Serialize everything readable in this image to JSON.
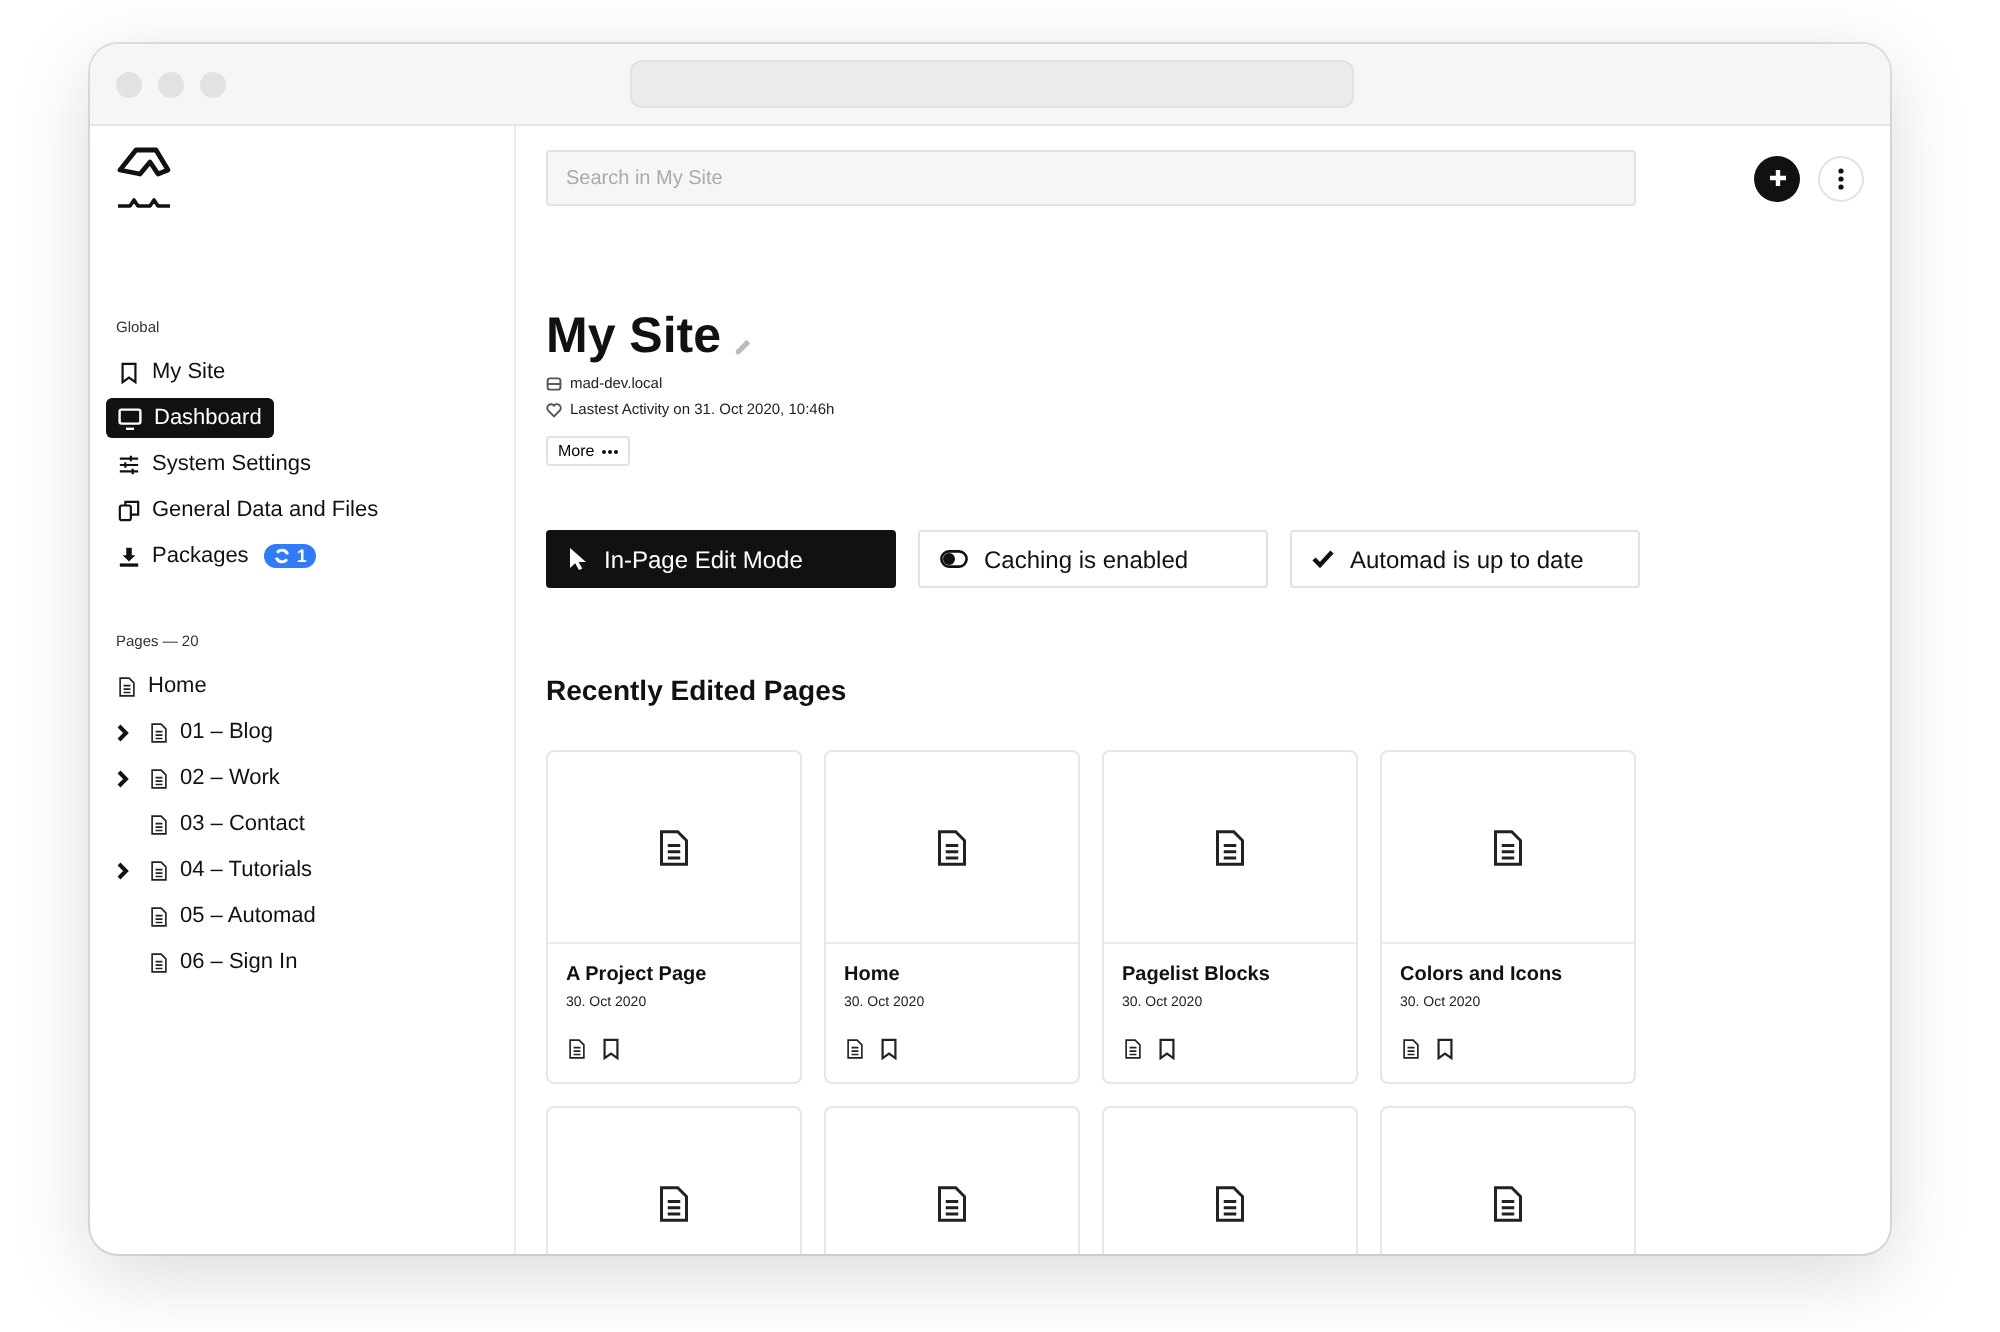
{
  "sidebar": {
    "sections": [
      {
        "title": "Global",
        "items": [
          {
            "label": "My Site",
            "selected": false
          },
          {
            "label": "Dashboard",
            "selected": true
          },
          {
            "label": "System Settings",
            "selected": false
          },
          {
            "label": "General Data and Files",
            "selected": false
          },
          {
            "label": "Packages",
            "selected": false,
            "badge": "1"
          }
        ]
      },
      {
        "title": "Pages — 20",
        "tree": [
          {
            "label": "Home"
          },
          {
            "label": "01 – Blog",
            "expandable": true
          },
          {
            "label": "02 – Work",
            "expandable": true
          },
          {
            "label": "03 – Contact",
            "expandable": false
          },
          {
            "label": "04 – Tutorials",
            "expandable": true
          },
          {
            "label": "05 – Automad",
            "expandable": false
          },
          {
            "label": "06 – Sign In",
            "expandable": false
          }
        ]
      }
    ]
  },
  "search": {
    "placeholder": "Search in My Site"
  },
  "site": {
    "title": "My Site",
    "host": "mad-dev.local",
    "activity": "Lastest Activity on 31. Oct 2020, 10:46h",
    "more": "More"
  },
  "status_buttons": [
    {
      "label": "In-Page Edit Mode",
      "kind": "pointer"
    },
    {
      "label": "Caching is enabled",
      "kind": "toggle"
    },
    {
      "label": "Automad is up to date",
      "kind": "check"
    }
  ],
  "recent": {
    "heading": "Recently Edited Pages",
    "cards": [
      {
        "kind": "page",
        "title": "A Project Page",
        "date": "30. Oct 2020"
      },
      {
        "kind": "page",
        "title": "Home",
        "date": "30. Oct 2020"
      },
      {
        "kind": "page",
        "title": "Pagelist Blocks",
        "date": "30. Oct 2020"
      },
      {
        "kind": "page",
        "title": "Colors and Icons",
        "date": "30. Oct 2020"
      },
      {
        "kind": "cutoff"
      },
      {
        "kind": "cutoff"
      },
      {
        "kind": "cutoff"
      },
      {
        "kind": "cutoff"
      }
    ]
  }
}
